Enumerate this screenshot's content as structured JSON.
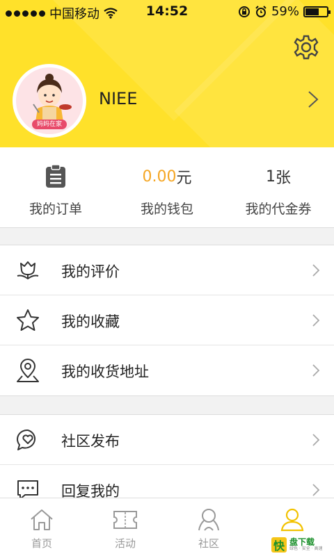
{
  "status_bar": {
    "carrier": "中国移动",
    "time": "14:52",
    "battery_text": "59%",
    "battery_level": 0.59
  },
  "profile": {
    "username": "NIEE",
    "avatar_badge": "妈妈在家",
    "settings_icon": "gear-icon",
    "arrow_icon": "chevron-right-icon"
  },
  "stats": {
    "orders": {
      "label": "我的订单",
      "icon": "clipboard-icon"
    },
    "wallet": {
      "amount": "0.00",
      "unit": "元",
      "label": "我的钱包"
    },
    "vouchers": {
      "count": "1",
      "unit": "张",
      "label": "我的代金券"
    }
  },
  "menu_group1": [
    {
      "label": "我的评价",
      "icon": "flower-icon"
    },
    {
      "label": "我的收藏",
      "icon": "star-icon"
    },
    {
      "label": "我的收货地址",
      "icon": "location-pin-icon"
    }
  ],
  "menu_group2": [
    {
      "label": "社区发布",
      "icon": "chat-heart-icon"
    },
    {
      "label": "回复我的",
      "icon": "chat-dots-icon"
    }
  ],
  "tabbar": [
    {
      "label": "首页",
      "icon": "home-icon",
      "active": false
    },
    {
      "label": "活动",
      "icon": "ticket-icon",
      "active": false
    },
    {
      "label": "社区",
      "icon": "community-icon",
      "active": false
    },
    {
      "label": "",
      "icon": "person-icon",
      "active": true
    }
  ],
  "watermark": {
    "logo": "快",
    "title": "盘下载",
    "subtitle": "绿色 · 安全 · 高速"
  },
  "colors": {
    "header": "#ffe12a",
    "accent_orange": "#f5a623",
    "tab_active": "#f2c200",
    "tab_inactive": "#999999"
  }
}
